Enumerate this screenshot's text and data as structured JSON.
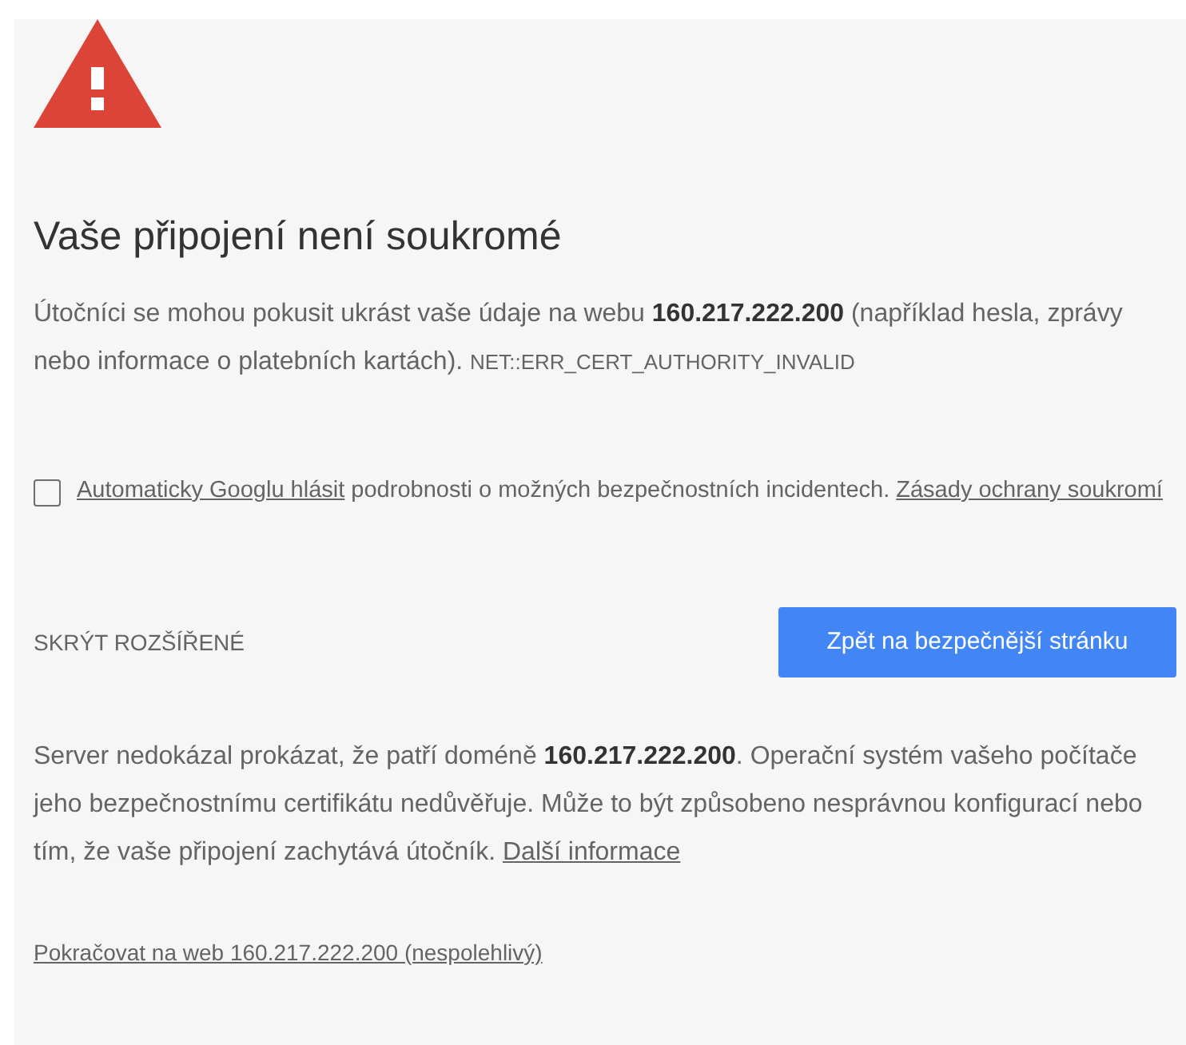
{
  "title": "Vaše připojení není soukromé",
  "summary": [
    {
      "kind": "text",
      "text": "Útočníci se mohou pokusit ukrást vaše údaje na webu **160.217.222.200** (například hesla, zprávy nebo informace o platebních kartách). "
    },
    {
      "kind": "code",
      "text": "NET::ERR_CERT_AUTHORITY_INVALID"
    }
  ],
  "report": {
    "checked": false,
    "parts": [
      {
        "kind": "link",
        "text": "Automaticky Googlu hlásit"
      },
      {
        "kind": "text",
        "text": " podrobnosti o možných bezpečnostních incidentech. "
      },
      {
        "kind": "link",
        "text": "Zásady ochrany soukromí"
      }
    ]
  },
  "details_toggle": "SKRÝT ROZŠÍŘENÉ",
  "primary_button": "Zpět na bezpečnější stránku",
  "details": [
    {
      "kind": "text",
      "text": "Server nedokázal prokázat, že patří doméně **160.217.222.200**. Operační systém vašeho počítače jeho bezpečnostnímu certifikátu nedůvěřuje. Může to být způsobeno nesprávnou konfigurací nebo tím, že vaše připojení zachytává útočník. "
    },
    {
      "kind": "link",
      "text": "Další informace"
    }
  ],
  "proceed_link": "Pokračovat na web 160.217.222.200 (nespolehlivý)"
}
